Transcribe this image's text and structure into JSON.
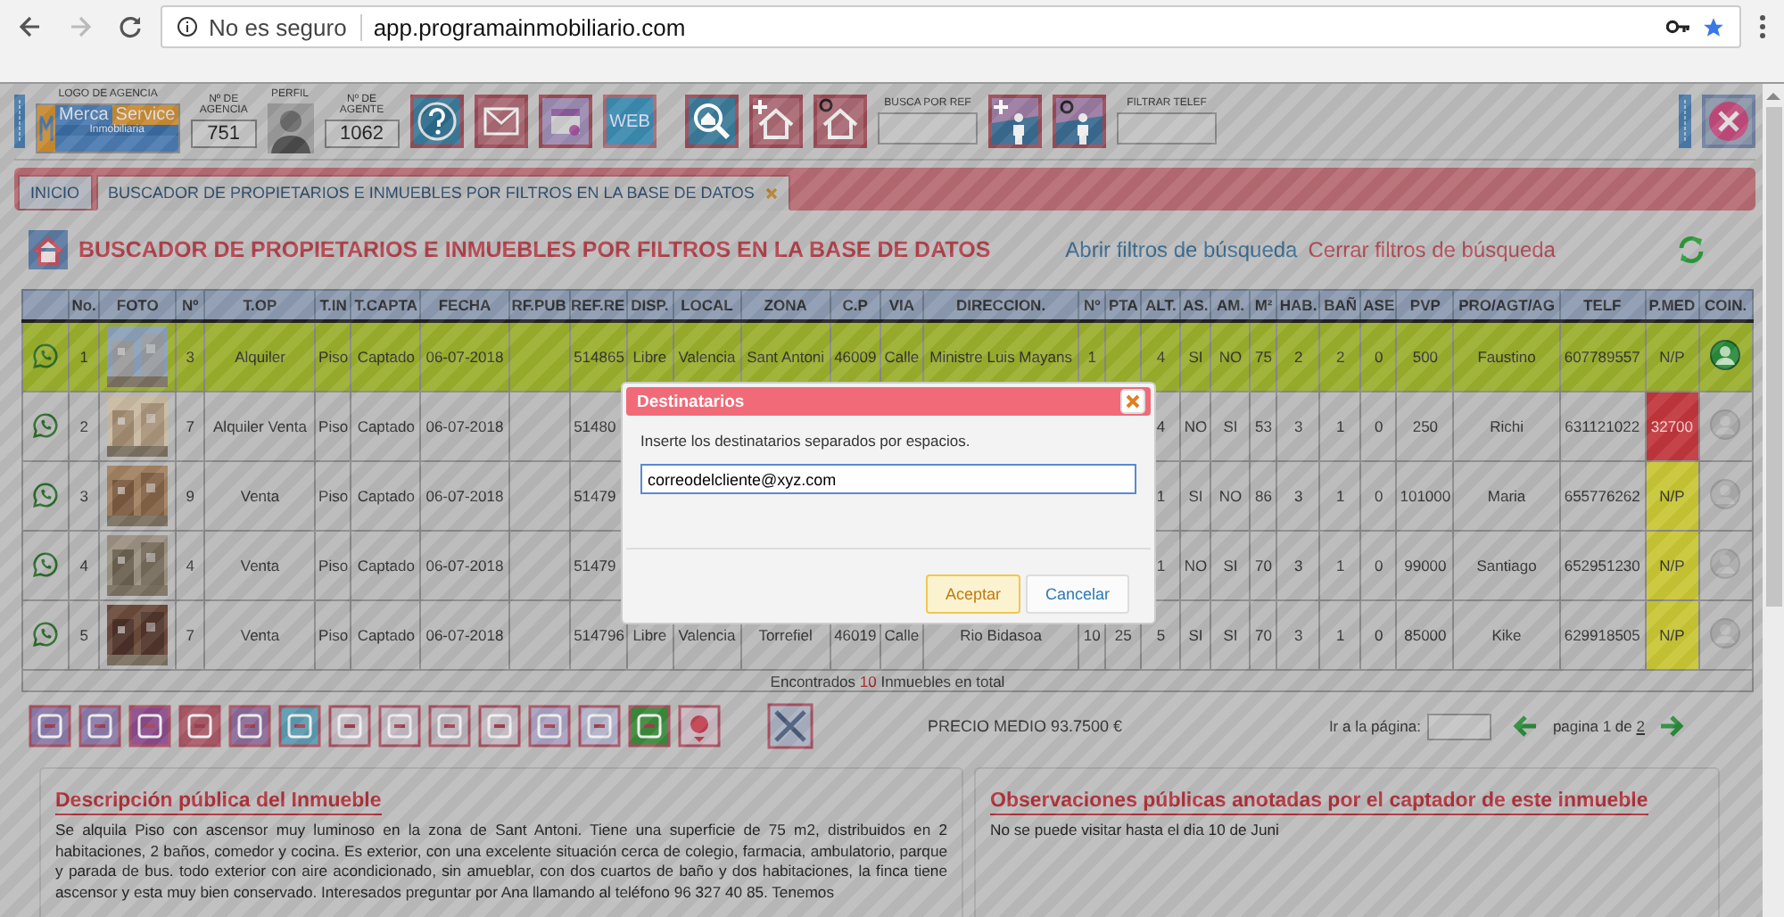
{
  "browser": {
    "security": "No es seguro",
    "url": "app.programainmobiliario.com"
  },
  "toolbar": {
    "logo_label": "LOGO DE AGENCIA",
    "logo_words": [
      "Merca",
      "Service",
      "Inmobiliaria"
    ],
    "agency_label": "Nº DE AGENCIA",
    "agency_number": "751",
    "profile_label": "PERFIL",
    "agent_label": "Nº DE AGENTE",
    "agent_number": "1062",
    "web_label": "WEB",
    "ref_search_label": "BUSCA POR REF",
    "phone_filter_label": "FILTRAR TELEF"
  },
  "tabs": [
    {
      "label": "INICIO",
      "selected": false
    },
    {
      "label": "BUSCADOR DE PROPIETARIOS E INMUEBLES POR FILTROS EN LA BASE DE DATOS",
      "selected": true
    }
  ],
  "page_title": "BUSCADOR DE PROPIETARIOS E INMUEBLES POR FILTROS EN LA BASE DE DATOS",
  "links": {
    "open": "Abrir filtros de búsqueda",
    "close": "Cerrar filtros de búsqueda"
  },
  "table": {
    "columns": [
      {
        "label": "No.",
        "kind": "text"
      },
      {
        "label": "FOTO"
      },
      {
        "label": "Nº",
        "kind": "text"
      },
      {
        "label": "T.OP",
        "kind": "text"
      },
      {
        "label": "T.IN",
        "kind": "text"
      },
      {
        "label": "T.CAPTA",
        "kind": "text"
      },
      {
        "label": "FECHA",
        "kind": "text"
      },
      {
        "label": "RF.PUB",
        "kind": "text"
      },
      {
        "label": "REF.RE",
        "kind": "text"
      },
      {
        "label": "DISP.",
        "kind": "text"
      },
      {
        "label": "LOCAL",
        "kind": "text"
      },
      {
        "label": "ZONA",
        "kind": "text"
      },
      {
        "label": "C.P",
        "kind": "text"
      },
      {
        "label": "VIA",
        "kind": "text"
      },
      {
        "label": "DIRECCION.",
        "kind": "text"
      },
      {
        "label": "Nº",
        "kind": "text"
      },
      {
        "label": "PTA",
        "kind": "text"
      },
      {
        "label": "ALT.",
        "kind": "text"
      },
      {
        "label": "AS.",
        "kind": "text"
      },
      {
        "label": "AM.",
        "kind": "text"
      },
      {
        "label": "M²",
        "kind": "text"
      },
      {
        "label": "HAB.",
        "kind": "text"
      },
      {
        "label": "BAÑ",
        "kind": "text"
      },
      {
        "label": "ASE",
        "kind": "text"
      },
      {
        "label": "PVP",
        "kind": "text"
      },
      {
        "label": "PRO/AGT/AG",
        "kind": "text"
      },
      {
        "label": "TELF",
        "kind": "text"
      },
      {
        "label": "P.MED",
        "kind": "pmed"
      },
      {
        "label": "COIN.",
        "kind": "coin"
      }
    ],
    "rows": [
      {
        "selected": true,
        "coin": true,
        "pmed": {
          "text": "N/P",
          "color": "#9aaf2c"
        },
        "cells": [
          "1",
          null,
          "3",
          "Alquiler",
          "Piso",
          "Captado",
          "06-07-2018",
          null,
          "514865",
          "Libre",
          "Valencia",
          "Sant Antoni",
          "46009",
          "Calle",
          "Ministre Luis Mayans",
          "1",
          null,
          "4",
          "SI",
          "NO",
          "75",
          "2",
          "2",
          "0",
          "500",
          "Faustino",
          "607789557"
        ]
      },
      {
        "selected": false,
        "coin": false,
        "pmed": {
          "text": "32700",
          "color": "#c0363c"
        },
        "cells": [
          "2",
          null,
          "7",
          "Alquiler Venta",
          "Piso",
          "Captado",
          "06-07-2018",
          null,
          "51480",
          null,
          null,
          null,
          null,
          null,
          null,
          null,
          null,
          "4",
          "NO",
          "SI",
          "53",
          "3",
          "1",
          "0",
          "250",
          "Richi",
          "631121022"
        ]
      },
      {
        "selected": false,
        "coin": false,
        "pmed": {
          "text": "N/P",
          "color": "#c8c634"
        },
        "cells": [
          "3",
          null,
          "9",
          "Venta",
          "Piso",
          "Captado",
          "06-07-2018",
          null,
          "51479",
          null,
          null,
          null,
          null,
          null,
          null,
          null,
          null,
          "1",
          "SI",
          "NO",
          "86",
          "3",
          "1",
          "0",
          "101000",
          "Maria",
          "655776262"
        ]
      },
      {
        "selected": false,
        "coin": false,
        "pmed": {
          "text": "N/P",
          "color": "#c8c634"
        },
        "cells": [
          "4",
          null,
          "4",
          "Venta",
          "Piso",
          "Captado",
          "06-07-2018",
          null,
          "51479",
          null,
          null,
          null,
          null,
          null,
          null,
          null,
          null,
          "1",
          "NO",
          "SI",
          "70",
          "3",
          "1",
          "0",
          "99000",
          "Santiago",
          "652951230"
        ]
      },
      {
        "selected": false,
        "coin": false,
        "pmed": {
          "text": "N/P",
          "color": "#c8c634"
        },
        "cells": [
          "5",
          null,
          "7",
          "Venta",
          "Piso",
          "Captado",
          "06-07-2018",
          null,
          "514796",
          "Libre",
          "Valencia",
          "Torrefiel",
          "46019",
          "Calle",
          "Rio Bidasoa",
          "10",
          "25",
          "5",
          "SI",
          "SI",
          "70",
          "3",
          "1",
          "0",
          "85000",
          "Kike",
          "629918505"
        ]
      }
    ],
    "footer": "Encontrados **10** Inmuebles en total"
  },
  "average_price": "PRECIO MEDIO 93.7500 €",
  "pager": {
    "goto_label": "Ir a la página:",
    "text": "pagina 1 de",
    "last_page": "2"
  },
  "description": {
    "title": "Descripción pública del Inmueble",
    "text": "Se alquila Piso con ascensor muy luminoso en la zona de Sant Antoni. Tiene una superficie de 75 m2, distribuidos en 2 habitaciones, 2 baños, comedor y cocina. Es exterior, con una excelente situación cerca de colegio, farmacia, ambulatorio, parque y parada de bus. todo exterior con aire acondicionado, sin amueblar, con dos cuartos de baño y dos habitaciones, la finca tiene ascensor y esta muy bien conservado. Interesados preguntar por Ana llamando al teléfono 96 327 40 85. Tenemos"
  },
  "observations": {
    "title": "Observaciones públicas anotadas por el captador de este inmueble",
    "text": "No se puede visitar hasta el dia 10 de Juni"
  },
  "dialog": {
    "title": "Destinatarios",
    "prompt": "Inserte los destinatarios separados por espacios.",
    "value": "correodelcliente@xyz.com",
    "buttons": [
      {
        "label": "Aceptar",
        "kind": "primary"
      },
      {
        "label": "Cancelar",
        "kind": "secondary"
      }
    ]
  }
}
